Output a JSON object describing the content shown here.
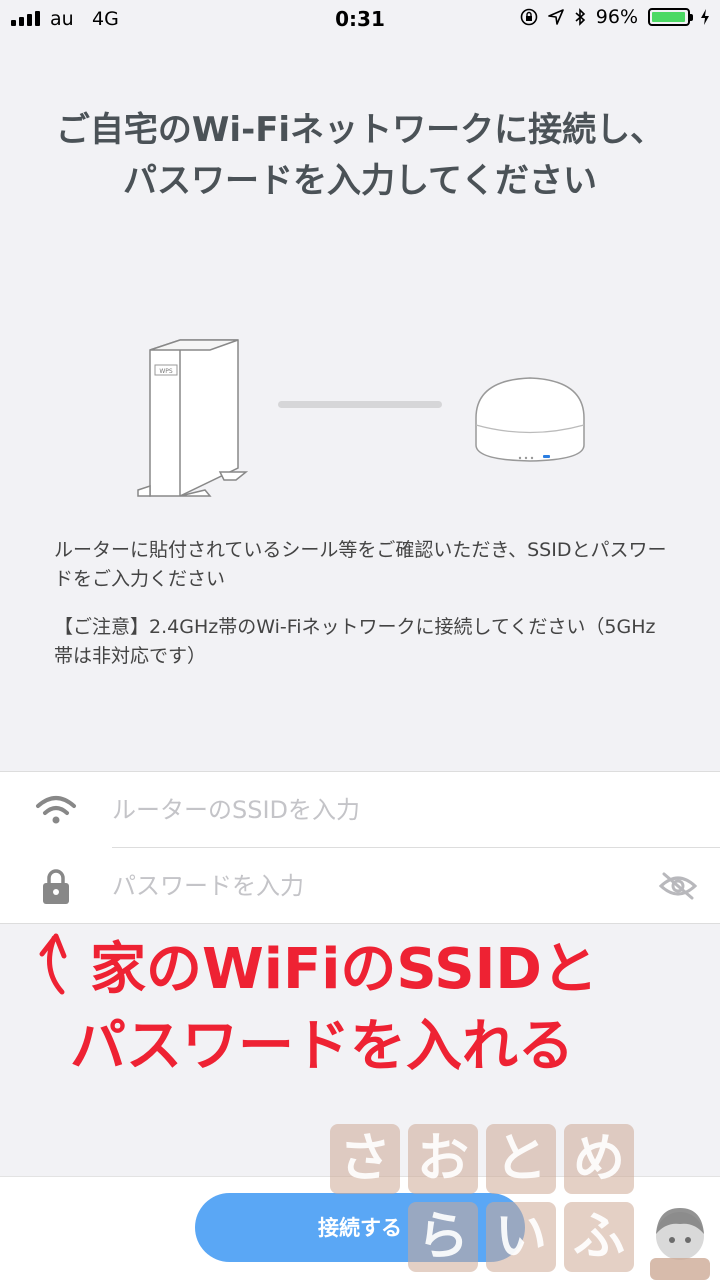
{
  "status_bar": {
    "carrier": "au",
    "network": "4G",
    "time": "0:31",
    "battery_percent": "96%",
    "battery_level": 0.96
  },
  "title": "ご自宅のWi-Fiネットワークに接続し、パスワードを入力してください",
  "illustration": {
    "router_label": "WPS"
  },
  "description": "ルーターに貼付されているシール等をご確認いただき、SSIDとパスワードをご入力ください",
  "notice": "【ご注意】2.4GHz帯のWi-Fiネットワークに接続してください（5GHz帯は非対応です）",
  "form": {
    "ssid_placeholder": "ルーターのSSIDを入力",
    "password_placeholder": "パスワードを入力",
    "ssid_icon": "wifi-icon",
    "password_icon": "lock-icon",
    "toggle_icon": "eye-off-icon"
  },
  "annotation": {
    "line1": "家のWiFiのSSIDと",
    "line2": "パスワードを入れる",
    "color": "#ee2233"
  },
  "connect_button": "接続する",
  "watermark": {
    "chars": [
      "さ",
      "お",
      "と",
      "め",
      "ら",
      "い",
      "ふ"
    ]
  },
  "colors": {
    "primary": "#5aa7f5",
    "title": "#4b5257",
    "background": "#f2f2f5"
  }
}
